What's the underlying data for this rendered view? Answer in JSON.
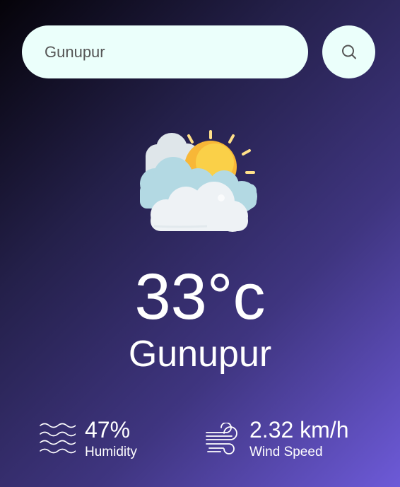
{
  "search": {
    "value": "Gunupur",
    "placeholder": "",
    "button_icon": "search-icon"
  },
  "weather": {
    "icon": "partly-cloudy-sun-icon",
    "temperature": "33°c",
    "city": "Gunupur"
  },
  "details": {
    "humidity": {
      "icon": "humidity-waves-icon",
      "value": "47%",
      "label": "Humidity"
    },
    "wind": {
      "icon": "wind-icon",
      "value": "2.32 km/h",
      "label": "Wind Speed"
    }
  },
  "colors": {
    "gradient_start": "#050309",
    "gradient_end": "#6d5ad8",
    "input_background": "#ebfffb",
    "text": "#ffffff"
  }
}
